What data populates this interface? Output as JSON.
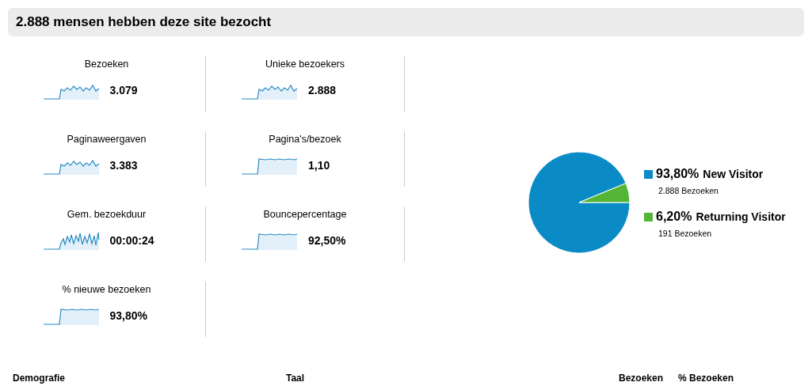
{
  "header": {
    "title": "2.888 mensen hebben deze site bezocht"
  },
  "metrics": [
    {
      "label": "Bezoeken",
      "value": "3.079",
      "kind": "wavy"
    },
    {
      "label": "Unieke bezoekers",
      "value": "2.888",
      "kind": "wavy"
    },
    {
      "label": "Paginaweergaven",
      "value": "3.383",
      "kind": "wavy"
    },
    {
      "label": "Pagina's/bezoek",
      "value": "1,10",
      "kind": "flat"
    },
    {
      "label": "Gem. bezoekduur",
      "value": "00:00:24",
      "kind": "noisy"
    },
    {
      "label": "Bouncepercentage",
      "value": "92,50%",
      "kind": "flat"
    },
    {
      "label": "% nieuwe bezoeken",
      "value": "93,80%",
      "kind": "flat"
    }
  ],
  "visitor_chart": {
    "chart_data": {
      "type": "pie",
      "categories": [
        "New Visitor",
        "Returning Visitor"
      ],
      "values": [
        93.8,
        6.2
      ],
      "colors": [
        "#0a8bc6",
        "#53b534"
      ]
    },
    "legend": [
      {
        "percent": "93,80%",
        "visits": "2.888 Bezoeken",
        "color": "#0a8bc6"
      },
      {
        "percent": "6,20%",
        "visits": "191 Bezoeken",
        "color": "#53b534"
      }
    ]
  },
  "table": {
    "columns": [
      "Demografie",
      "Taal",
      "Bezoeken",
      "% Bezoeken"
    ]
  }
}
